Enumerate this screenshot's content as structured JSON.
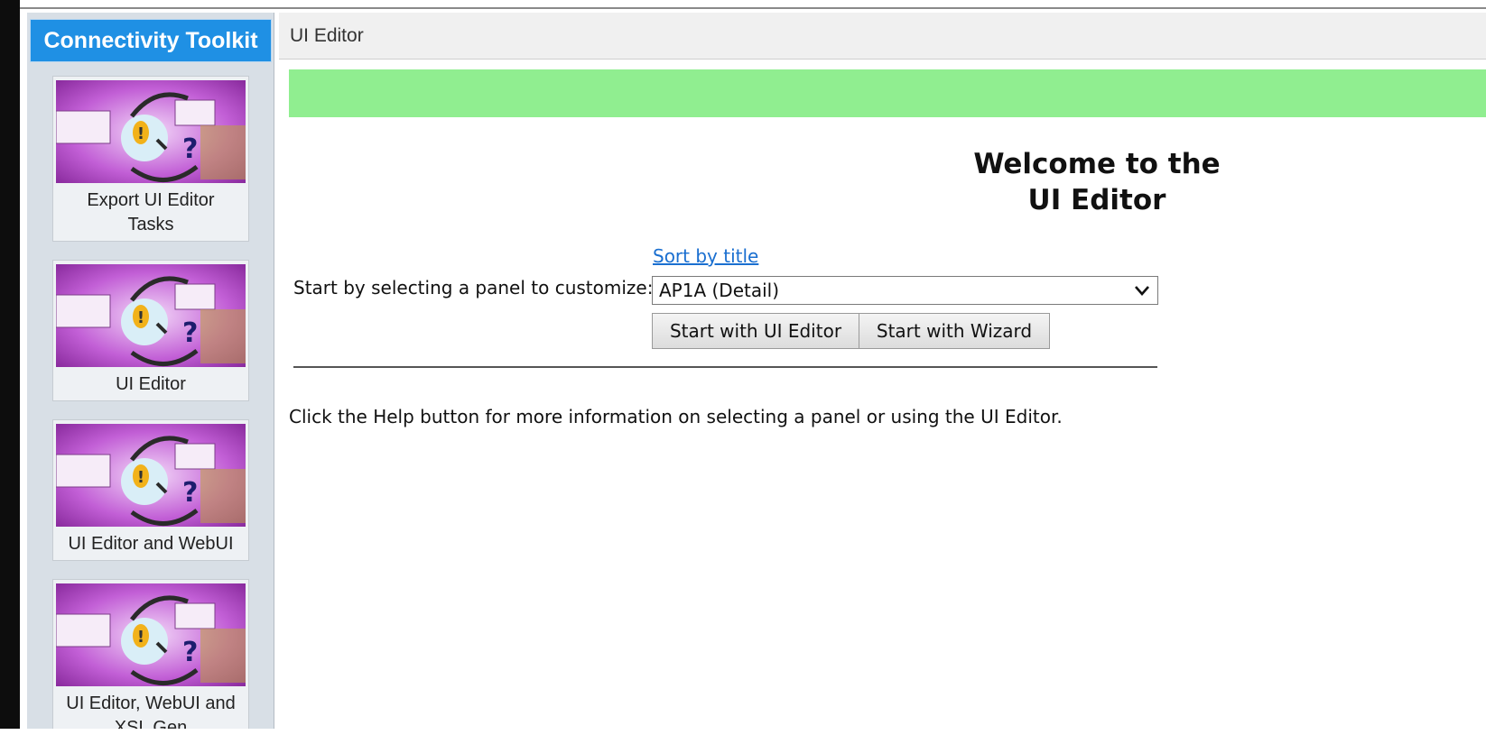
{
  "sidebar": {
    "title": "Connectivity Toolkit",
    "items": [
      {
        "label": "Export UI Editor\nTasks",
        "icon": "toolkit-thumbnail-icon"
      },
      {
        "label": "UI Editor",
        "icon": "toolkit-thumbnail-icon"
      },
      {
        "label": "UI Editor and WebUI",
        "icon": "toolkit-thumbnail-icon"
      },
      {
        "label": "UI Editor, WebUI and\nXSL Gen",
        "icon": "toolkit-thumbnail-icon"
      }
    ]
  },
  "main": {
    "title": "UI Editor",
    "welcome_line1": "Welcome to the",
    "welcome_line2": "UI Editor",
    "sort_link": "Sort by title",
    "select_label": "Start by selecting a panel to customize:",
    "selected_panel": "AP1A (Detail)",
    "start_ui_editor": "Start with UI Editor",
    "start_wizard": "Start with Wizard",
    "help_text": "Click the Help button for more information on selecting a panel or using the UI Editor."
  },
  "colors": {
    "sidebar_header": "#1f90e4",
    "banner": "#90ee90",
    "link": "#1a6fd0"
  }
}
